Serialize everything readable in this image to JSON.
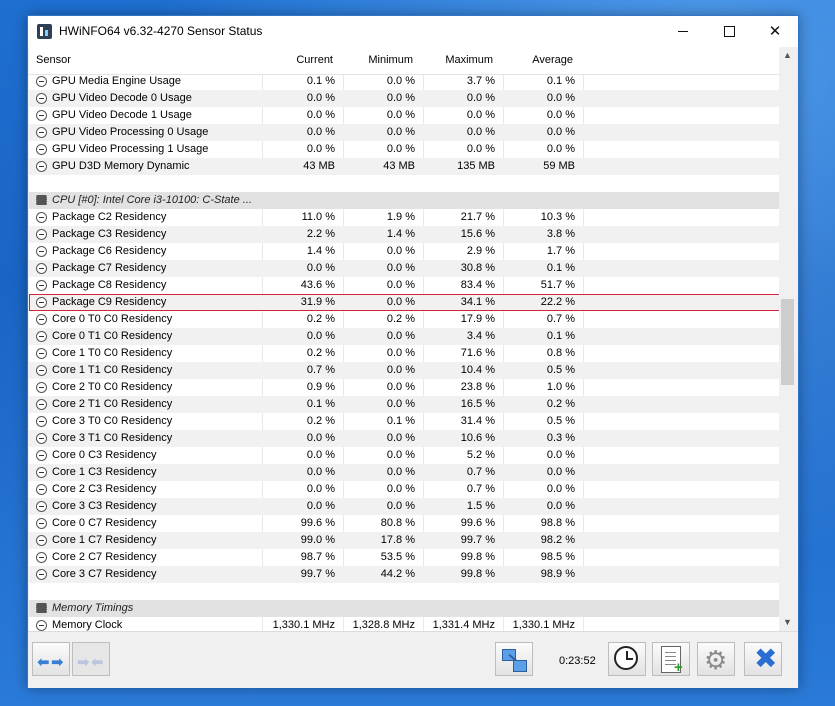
{
  "window": {
    "title": "HWiNFO64 v6.32-4270 Sensor Status"
  },
  "columns": {
    "sensor": "Sensor",
    "current": "Current",
    "minimum": "Minimum",
    "maximum": "Maximum",
    "average": "Average"
  },
  "rows": [
    {
      "type": "data",
      "name": "GPU Media Engine Usage",
      "cur": "0.1 %",
      "min": "0.0 %",
      "max": "3.7 %",
      "avg": "0.1 %"
    },
    {
      "type": "data",
      "name": "GPU Video Decode 0 Usage",
      "cur": "0.0 %",
      "min": "0.0 %",
      "max": "0.0 %",
      "avg": "0.0 %"
    },
    {
      "type": "data",
      "name": "GPU Video Decode 1 Usage",
      "cur": "0.0 %",
      "min": "0.0 %",
      "max": "0.0 %",
      "avg": "0.0 %"
    },
    {
      "type": "data",
      "name": "GPU Video Processing 0 Usage",
      "cur": "0.0 %",
      "min": "0.0 %",
      "max": "0.0 %",
      "avg": "0.0 %"
    },
    {
      "type": "data",
      "name": "GPU Video Processing 1 Usage",
      "cur": "0.0 %",
      "min": "0.0 %",
      "max": "0.0 %",
      "avg": "0.0 %"
    },
    {
      "type": "data",
      "name": "GPU D3D Memory Dynamic",
      "cur": "43 MB",
      "min": "43 MB",
      "max": "135 MB",
      "avg": "59 MB"
    },
    {
      "type": "gap"
    },
    {
      "type": "group",
      "name": "CPU [#0]: Intel Core i3-10100: C-State ..."
    },
    {
      "type": "data",
      "name": "Package C2 Residency",
      "cur": "11.0 %",
      "min": "1.9 %",
      "max": "21.7 %",
      "avg": "10.3 %"
    },
    {
      "type": "data",
      "name": "Package C3 Residency",
      "cur": "2.2 %",
      "min": "1.4 %",
      "max": "15.6 %",
      "avg": "3.8 %"
    },
    {
      "type": "data",
      "name": "Package C6 Residency",
      "cur": "1.4 %",
      "min": "0.0 %",
      "max": "2.9 %",
      "avg": "1.7 %"
    },
    {
      "type": "data",
      "name": "Package C7 Residency",
      "cur": "0.0 %",
      "min": "0.0 %",
      "max": "30.8 %",
      "avg": "0.1 %"
    },
    {
      "type": "data",
      "name": "Package C8 Residency",
      "cur": "43.6 %",
      "min": "0.0 %",
      "max": "83.4 %",
      "avg": "51.7 %"
    },
    {
      "type": "data",
      "name": "Package C9 Residency",
      "cur": "31.9 %",
      "min": "0.0 %",
      "max": "34.1 %",
      "avg": "22.2 %",
      "selected": true
    },
    {
      "type": "data",
      "name": "Core 0 T0 C0 Residency",
      "cur": "0.2 %",
      "min": "0.2 %",
      "max": "17.9 %",
      "avg": "0.7 %"
    },
    {
      "type": "data",
      "name": "Core 0 T1 C0 Residency",
      "cur": "0.0 %",
      "min": "0.0 %",
      "max": "3.4 %",
      "avg": "0.1 %"
    },
    {
      "type": "data",
      "name": "Core 1 T0 C0 Residency",
      "cur": "0.2 %",
      "min": "0.0 %",
      "max": "71.6 %",
      "avg": "0.8 %"
    },
    {
      "type": "data",
      "name": "Core 1 T1 C0 Residency",
      "cur": "0.7 %",
      "min": "0.0 %",
      "max": "10.4 %",
      "avg": "0.5 %"
    },
    {
      "type": "data",
      "name": "Core 2 T0 C0 Residency",
      "cur": "0.9 %",
      "min": "0.0 %",
      "max": "23.8 %",
      "avg": "1.0 %"
    },
    {
      "type": "data",
      "name": "Core 2 T1 C0 Residency",
      "cur": "0.1 %",
      "min": "0.0 %",
      "max": "16.5 %",
      "avg": "0.2 %"
    },
    {
      "type": "data",
      "name": "Core 3 T0 C0 Residency",
      "cur": "0.2 %",
      "min": "0.1 %",
      "max": "31.4 %",
      "avg": "0.5 %"
    },
    {
      "type": "data",
      "name": "Core 3 T1 C0 Residency",
      "cur": "0.0 %",
      "min": "0.0 %",
      "max": "10.6 %",
      "avg": "0.3 %"
    },
    {
      "type": "data",
      "name": "Core 0 C3 Residency",
      "cur": "0.0 %",
      "min": "0.0 %",
      "max": "5.2 %",
      "avg": "0.0 %"
    },
    {
      "type": "data",
      "name": "Core 1 C3 Residency",
      "cur": "0.0 %",
      "min": "0.0 %",
      "max": "0.7 %",
      "avg": "0.0 %"
    },
    {
      "type": "data",
      "name": "Core 2 C3 Residency",
      "cur": "0.0 %",
      "min": "0.0 %",
      "max": "0.7 %",
      "avg": "0.0 %"
    },
    {
      "type": "data",
      "name": "Core 3 C3 Residency",
      "cur": "0.0 %",
      "min": "0.0 %",
      "max": "1.5 %",
      "avg": "0.0 %"
    },
    {
      "type": "data",
      "name": "Core 0 C7 Residency",
      "cur": "99.6 %",
      "min": "80.8 %",
      "max": "99.6 %",
      "avg": "98.8 %"
    },
    {
      "type": "data",
      "name": "Core 1 C7 Residency",
      "cur": "99.0 %",
      "min": "17.8 %",
      "max": "99.7 %",
      "avg": "98.2 %"
    },
    {
      "type": "data",
      "name": "Core 2 C7 Residency",
      "cur": "98.7 %",
      "min": "53.5 %",
      "max": "99.8 %",
      "avg": "98.5 %"
    },
    {
      "type": "data",
      "name": "Core 3 C7 Residency",
      "cur": "99.7 %",
      "min": "44.2 %",
      "max": "99.8 %",
      "avg": "98.9 %"
    },
    {
      "type": "gap"
    },
    {
      "type": "group",
      "name": "Memory Timings"
    },
    {
      "type": "data",
      "name": "Memory Clock",
      "cur": "1,330.1 MHz",
      "min": "1,328.8 MHz",
      "max": "1,331.4 MHz",
      "avg": "1,330.1 MHz"
    }
  ],
  "toolbar": {
    "timer": "0:23:52",
    "icons": [
      "nav-left-right-icon",
      "nav-disabled-icon",
      "network-icon",
      "clock-icon",
      "report-add-icon",
      "settings-gear-icon",
      "close-x-icon"
    ]
  }
}
